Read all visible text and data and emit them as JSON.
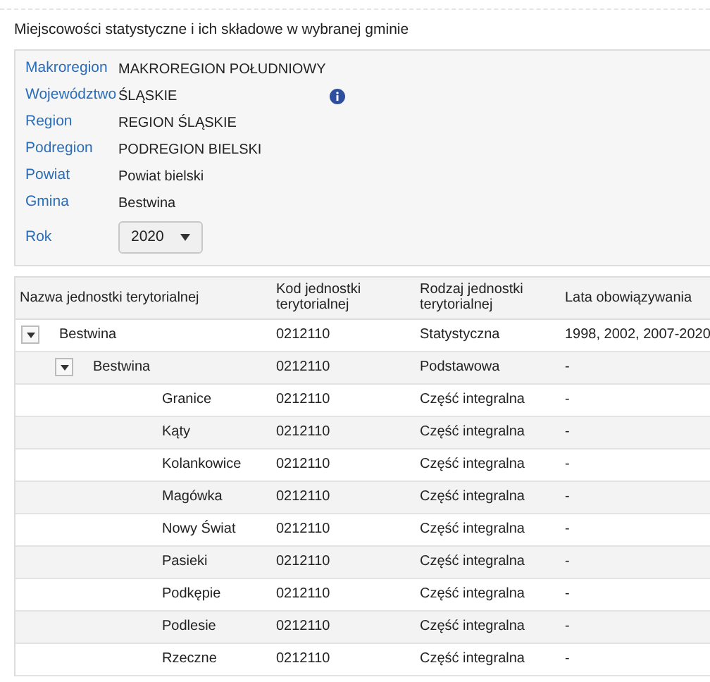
{
  "title": "Miejscowości statystyczne i ich składowe w wybranej gminie",
  "details": [
    {
      "label": "Makroregion",
      "value": "MAKROREGION POŁUDNIOWY",
      "info": false
    },
    {
      "label": "Województwo",
      "value": "ŚLĄSKIE",
      "info": true
    },
    {
      "label": "Region",
      "value": "REGION ŚLĄSKIE",
      "info": false
    },
    {
      "label": "Podregion",
      "value": "PODREGION BIELSKI",
      "info": false
    },
    {
      "label": "Powiat",
      "value": "Powiat bielski",
      "info": false
    },
    {
      "label": "Gmina",
      "value": "Bestwina",
      "info": false
    }
  ],
  "year": {
    "label": "Rok",
    "value": "2020"
  },
  "table": {
    "columns": [
      "Nazwa jednostki terytorialnej",
      "Kod jednostki terytorialnej",
      "Rodzaj jednostki terytorialnej",
      "Lata obowiązywania"
    ],
    "rows": [
      {
        "name": "Bestwina",
        "code": "0212110",
        "type": "Statystyczna",
        "years": "1998, 2002, 2007-2020",
        "expanded": true,
        "children": [
          {
            "name": "Bestwina",
            "code": "0212110",
            "type": "Podstawowa",
            "years": "-",
            "expanded": true,
            "children": [
              {
                "name": "Granice",
                "code": "0212110",
                "type": "Część integralna",
                "years": "-"
              },
              {
                "name": "Kąty",
                "code": "0212110",
                "type": "Część integralna",
                "years": "-"
              },
              {
                "name": "Kolankowice",
                "code": "0212110",
                "type": "Część integralna",
                "years": "-"
              },
              {
                "name": "Magówka",
                "code": "0212110",
                "type": "Część integralna",
                "years": "-"
              },
              {
                "name": "Nowy Świat",
                "code": "0212110",
                "type": "Część integralna",
                "years": "-"
              },
              {
                "name": "Pasieki",
                "code": "0212110",
                "type": "Część integralna",
                "years": "-"
              },
              {
                "name": "Podkępie",
                "code": "0212110",
                "type": "Część integralna",
                "years": "-"
              },
              {
                "name": "Podlesie",
                "code": "0212110",
                "type": "Część integralna",
                "years": "-"
              },
              {
                "name": "Rzeczne",
                "code": "0212110",
                "type": "Część integralna",
                "years": "-"
              }
            ]
          }
        ]
      }
    ]
  }
}
